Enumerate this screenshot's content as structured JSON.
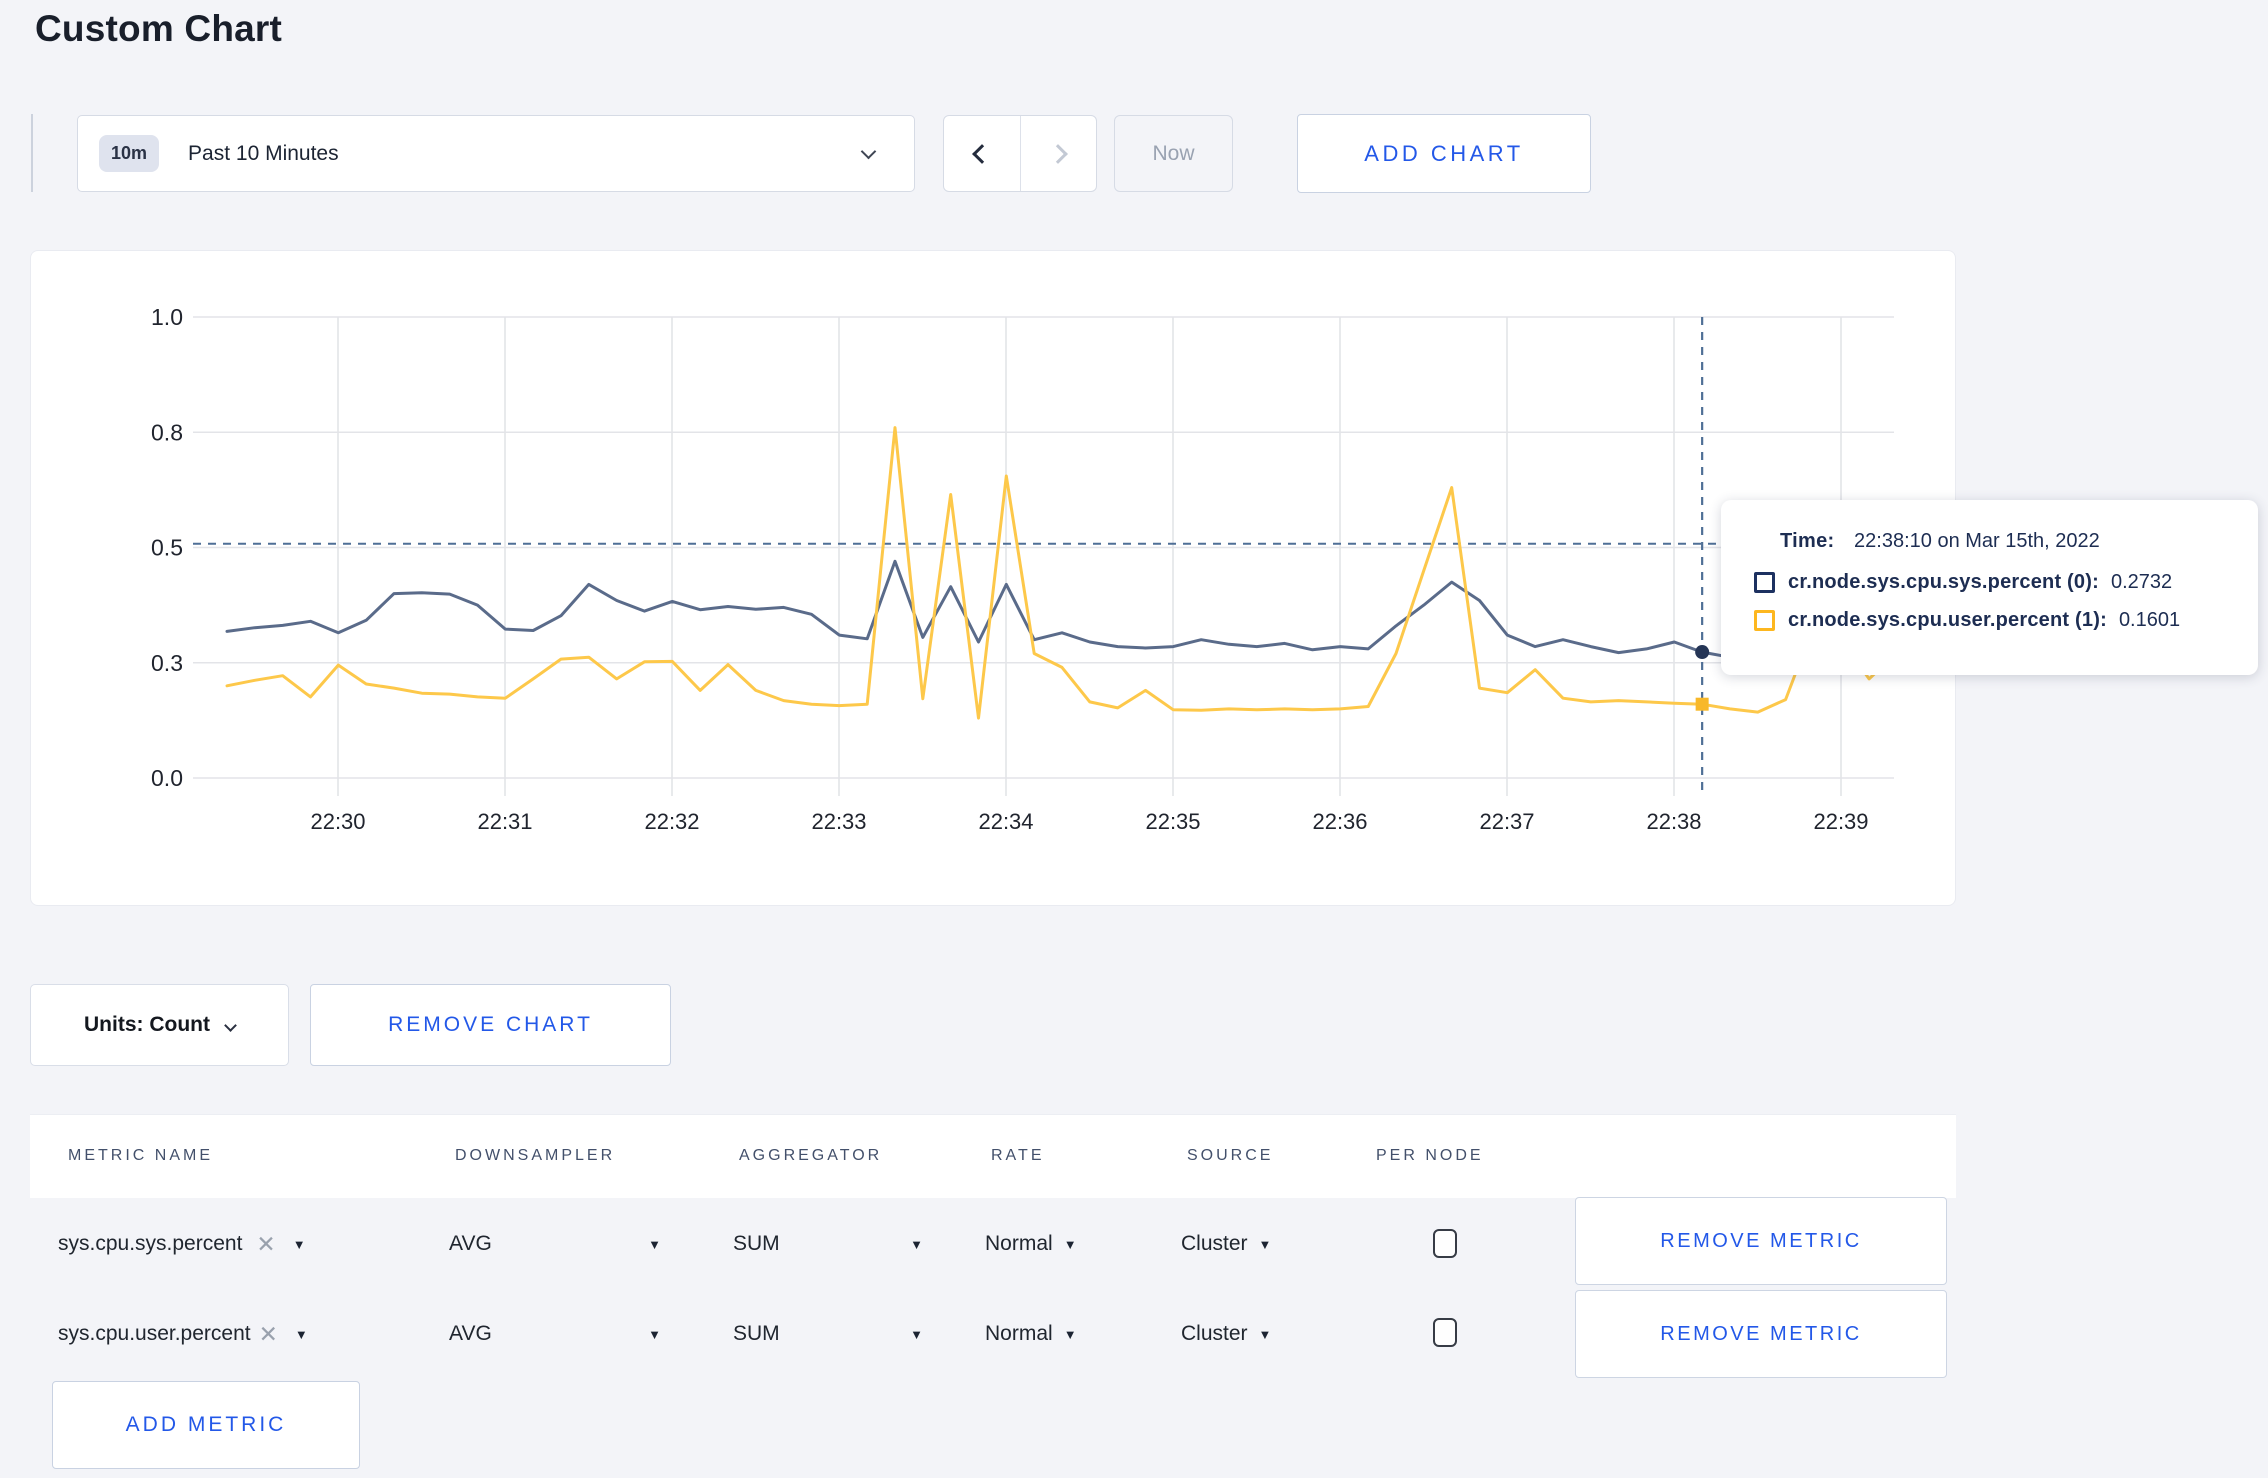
{
  "header": {
    "title": "Custom Chart"
  },
  "toolbar": {
    "time_range": {
      "badge": "10m",
      "label": "Past 10 Minutes"
    },
    "now_label": "Now",
    "add_chart_label": "ADD CHART"
  },
  "tooltip": {
    "time_label": "Time:",
    "time_value": "22:38:10 on Mar 15th, 2022",
    "series": [
      {
        "label": "cr.node.sys.cpu.sys.percent (0):",
        "value": "0.2732",
        "square_color": "#1d3160"
      },
      {
        "label": "cr.node.sys.cpu.user.percent (1):",
        "value": "0.1601",
        "square_color": "#fdb71f"
      }
    ]
  },
  "chart_controls": {
    "units_label": "Units: Count",
    "remove_chart_label": "REMOVE CHART"
  },
  "metrics_table": {
    "headers": [
      "METRIC NAME",
      "DOWNSAMPLER",
      "AGGREGATOR",
      "RATE",
      "SOURCE",
      "PER NODE"
    ],
    "rows": [
      {
        "metric": "sys.cpu.sys.percent",
        "downsampler": "AVG",
        "aggregator": "SUM",
        "rate": "Normal",
        "source": "Cluster",
        "per_node_checked": false,
        "remove_label": "REMOVE METRIC"
      },
      {
        "metric": "sys.cpu.user.percent",
        "downsampler": "AVG",
        "aggregator": "SUM",
        "rate": "Normal",
        "source": "Cluster",
        "per_node_checked": false,
        "remove_label": "REMOVE METRIC"
      }
    ],
    "add_metric_label": "ADD METRIC"
  },
  "colors": {
    "accent_blue": "#2358e8",
    "page_background": "#f3f4f8",
    "grid": "#e3e4e8",
    "crosshair": "#4f6f96",
    "sys_line": "#5a6b8a",
    "user_line": "#fdc84a"
  },
  "chart_data": {
    "type": "line",
    "title": "",
    "xlabel": "",
    "ylabel": "",
    "x_axis": {
      "tick_labels": [
        "22:30",
        "22:31",
        "22:32",
        "22:33",
        "22:34",
        "22:35",
        "22:36",
        "22:37",
        "22:38",
        "22:39"
      ],
      "start_time": "22:29:20",
      "end_time": "22:39:20",
      "sample_interval_seconds": 10
    },
    "y_axis": {
      "range": [
        0,
        1
      ],
      "ticks": [
        {
          "label": "1.0",
          "value": 1.0
        },
        {
          "label": "0.8",
          "value": 0.75
        },
        {
          "label": "0.5",
          "value": 0.5
        },
        {
          "label": "0.3",
          "value": 0.25
        },
        {
          "label": "0.0",
          "value": 0.0
        }
      ],
      "grid": true
    },
    "series": [
      {
        "name": "cr.node.sys.cpu.sys.percent",
        "color": "#5a6b8a",
        "values": [
          0.318,
          0.326,
          0.331,
          0.34,
          0.315,
          0.342,
          0.4,
          0.402,
          0.399,
          0.375,
          0.323,
          0.32,
          0.352,
          0.42,
          0.385,
          0.362,
          0.383,
          0.365,
          0.372,
          0.366,
          0.37,
          0.355,
          0.31,
          0.302,
          0.47,
          0.305,
          0.415,
          0.295,
          0.42,
          0.3,
          0.315,
          0.295,
          0.285,
          0.282,
          0.285,
          0.3,
          0.29,
          0.285,
          0.292,
          0.278,
          0.285,
          0.28,
          0.33,
          0.375,
          0.425,
          0.385,
          0.31,
          0.285,
          0.3,
          0.285,
          0.272,
          0.28,
          0.295,
          0.2732,
          0.262,
          0.28,
          0.272,
          0.264,
          0.262,
          0.266,
          0.27
        ]
      },
      {
        "name": "cr.node.sys.cpu.user.percent",
        "color": "#fdc84a",
        "values": [
          0.2,
          0.212,
          0.222,
          0.176,
          0.245,
          0.204,
          0.195,
          0.184,
          0.182,
          0.176,
          0.173,
          0.215,
          0.258,
          0.262,
          0.215,
          0.252,
          0.253,
          0.19,
          0.246,
          0.19,
          0.168,
          0.16,
          0.157,
          0.16,
          0.76,
          0.172,
          0.615,
          0.13,
          0.655,
          0.27,
          0.24,
          0.165,
          0.152,
          0.19,
          0.148,
          0.147,
          0.15,
          0.148,
          0.15,
          0.148,
          0.15,
          0.155,
          0.27,
          0.45,
          0.63,
          0.195,
          0.185,
          0.235,
          0.173,
          0.165,
          0.168,
          0.165,
          0.162,
          0.1601,
          0.15,
          0.143,
          0.17,
          0.33,
          0.3,
          0.215,
          0.272
        ]
      }
    ],
    "crosshair": {
      "time": "22:38:10",
      "sample_index": 53,
      "hline_value": 0.508,
      "markers": [
        {
          "series": 0,
          "value": 0.2732,
          "color": "#253556",
          "shape": "circle"
        },
        {
          "series": 1,
          "value": 0.1601,
          "color": "#f8b829",
          "shape": "square"
        }
      ]
    },
    "legend_position": "tooltip"
  }
}
